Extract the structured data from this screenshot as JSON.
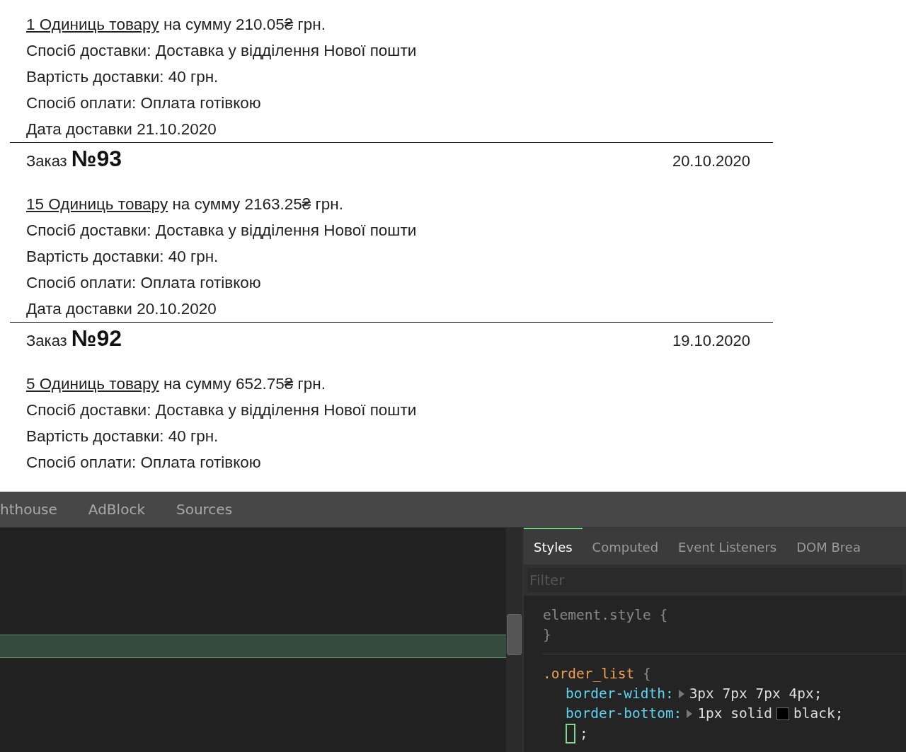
{
  "orders": [
    {
      "items_link": "1 Одиниць товару",
      "summary": " на сумму 210.05₴ грн.",
      "lines": [
        "Спосіб доставки: Доставка у відділення Нової пошти",
        "Вартість доставки: 40 грн.",
        "Спосіб оплати: Оплата готівкою",
        "Дата доставки 21.10.2020"
      ]
    },
    {
      "header": {
        "label": "Заказ",
        "number": "№93",
        "date": "20.10.2020"
      },
      "items_link": "15 Одиниць товару",
      "summary": " на сумму 2163.25₴ грн.",
      "lines": [
        "Спосіб доставки: Доставка у відділення Нової пошти",
        "Вартість доставки: 40 грн.",
        "Спосіб оплати: Оплата готівкою",
        "Дата доставки 20.10.2020"
      ]
    },
    {
      "header": {
        "label": "Заказ",
        "number": "№92",
        "date": "19.10.2020"
      },
      "items_link": "5 Одиниць товару",
      "summary": " на сумму 652.75₴ грн.",
      "lines": [
        "Спосіб доставки: Доставка у відділення Нової пошти",
        "Вартість доставки: 40 грн.",
        "Спосіб оплати: Оплата готівкою"
      ]
    }
  ],
  "devtools": {
    "tabs": [
      {
        "label": "hthouse",
        "selected": false
      },
      {
        "label": "AdBlock",
        "selected": false
      },
      {
        "label": "Sources",
        "selected": false
      }
    ],
    "sidebar_tabs": [
      {
        "label": "Styles",
        "selected": true
      },
      {
        "label": "Computed",
        "selected": false
      },
      {
        "label": "Event Listeners",
        "selected": false
      },
      {
        "label": "DOM Brea",
        "selected": false
      }
    ],
    "filter": {
      "placeholder": "Filter"
    },
    "rules": [
      {
        "kind": "inline",
        "selector": "element.style",
        "open": "{",
        "close": "}"
      },
      {
        "kind": "class",
        "selector": ".order_list",
        "open": "{",
        "declarations": [
          {
            "property": "border-width:",
            "value": "3px 7px 7px 4px;"
          },
          {
            "property": "border-bottom:",
            "value": "1px solid",
            "color": "#000000",
            "value_after": "black;"
          }
        ],
        "editing": {
          "text": ";"
        }
      }
    ]
  }
}
